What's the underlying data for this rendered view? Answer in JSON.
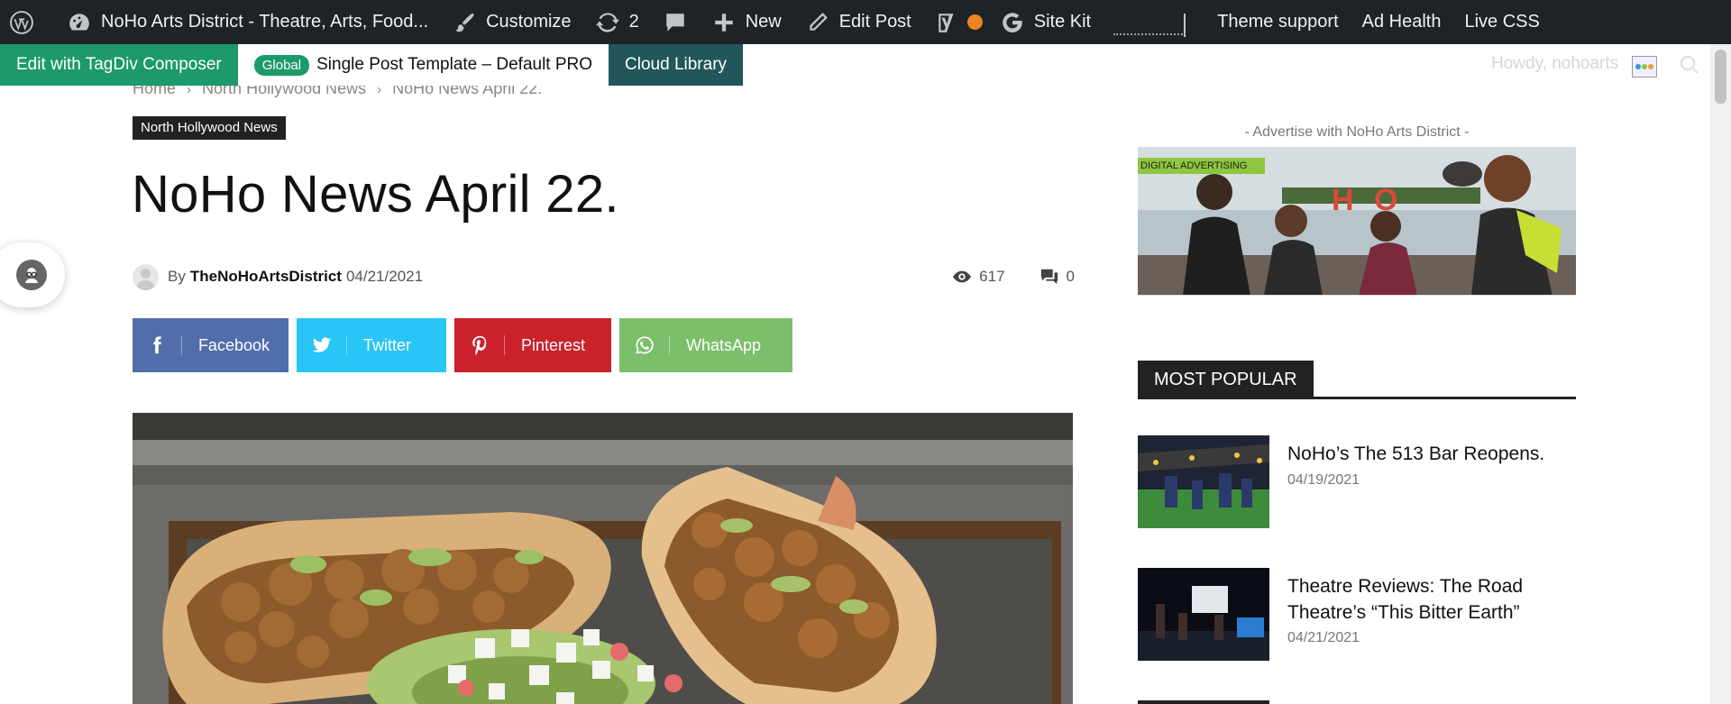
{
  "admin_bar": {
    "site_name": "NoHo Arts District - Theatre, Arts, Food...",
    "customize": "Customize",
    "updates_count": "2",
    "new": "New",
    "edit_post": "Edit Post",
    "site_kit": "Site Kit",
    "theme_support": "Theme support",
    "ad_health": "Ad Health",
    "live_css": "Live CSS",
    "howdy": "Howdy, nohoarts"
  },
  "composer_bar": {
    "edit": "Edit with TagDiv Composer",
    "badge": "Global",
    "template": "Single Post Template – Default PRO",
    "cloud": "Cloud Library"
  },
  "breadcrumb": {
    "items": [
      "Home",
      "North Hollywood News",
      "NoHo News April 22."
    ],
    "separator": "›"
  },
  "post": {
    "category": "North Hollywood News",
    "title": "NoHo News April 22.",
    "by": "By",
    "author": "TheNoHoArtsDistrict",
    "date": "04/21/2021",
    "views": "617",
    "comments": "0"
  },
  "share": [
    {
      "label": "Facebook",
      "icon": "facebook-icon",
      "color": "#516eab"
    },
    {
      "label": "Twitter",
      "icon": "twitter-icon",
      "color": "#29c5f6"
    },
    {
      "label": "Pinterest",
      "icon": "pinterest-icon",
      "color": "#ca212a"
    },
    {
      "label": "WhatsApp",
      "icon": "whatsapp-icon",
      "color": "#7bbf6a"
    }
  ],
  "sidebar": {
    "ad_label": "- Advertise with NoHo Arts District -",
    "ad_tag": "DIGITAL ADVERTISING",
    "popular_heading": "MOST POPULAR",
    "popular": [
      {
        "title": "NoHo’s The 513 Bar Reopens.",
        "date": "04/19/2021"
      },
      {
        "title": "Theatre Reviews: The Road Theatre’s “This Bitter Earth”",
        "date": "04/21/2021"
      }
    ]
  },
  "colors": {
    "admin_bg": "#1d2327",
    "composer_green": "#1c9a6a",
    "cloud_teal": "#22565c",
    "site_kit_dot": "#f08321"
  }
}
